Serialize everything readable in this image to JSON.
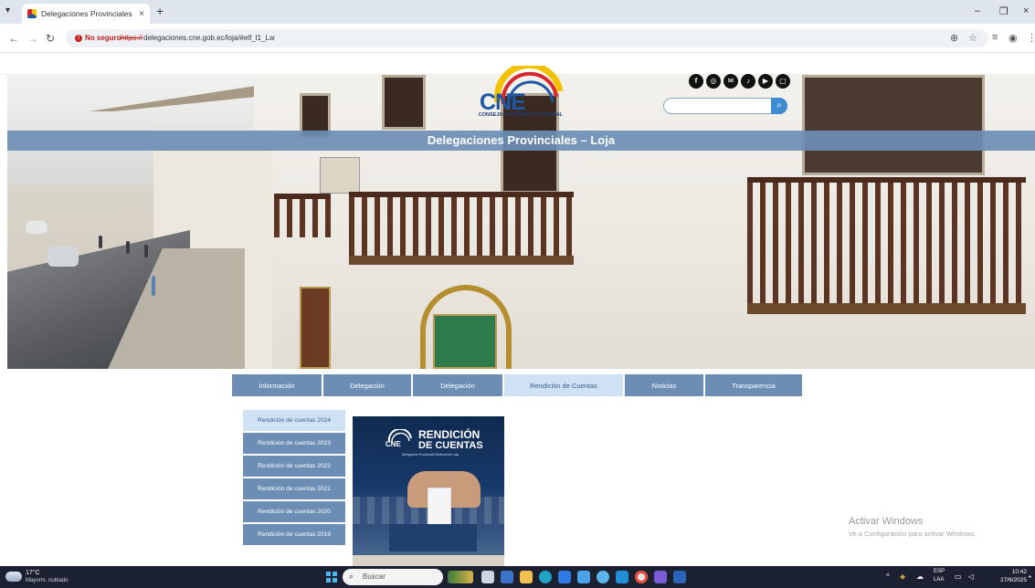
{
  "browser": {
    "tab_title": "Delegaciones Provinciales – Loj",
    "new_tab": "+",
    "close_glyph": "×",
    "menu_glyph": "▾",
    "window_minimize": "–",
    "window_restore": "❐",
    "window_close": "×",
    "insecure_label": "No seguro",
    "url_scheme": "https://",
    "url_rest": "delegaciones.cne.gob.ec/loja/#elf_l1_Lw",
    "icons": [
      "back-icon",
      "forward-icon",
      "reload-icon",
      "zoom-icon",
      "star-icon",
      "extensions-icon",
      "profile-icon",
      "more-icon"
    ]
  },
  "header": {
    "logo_text": "CNE",
    "logo_subtitle": "CONSEJO NACIONAL ELECTORAL",
    "social": [
      "f",
      "◎",
      "✉",
      "♪",
      "▶",
      "▢"
    ],
    "search_placeholder": "",
    "search_glyph": "🔍",
    "page_title": "Delegaciones Provinciales – Loja"
  },
  "menu": [
    {
      "label": "Información",
      "active": false
    },
    {
      "label": "Delegación",
      "active": false
    },
    {
      "label": "Delegación",
      "active": false
    },
    {
      "label": "Rendición de Cuentas",
      "active": true
    },
    {
      "label": "Noticias",
      "active": false
    },
    {
      "label": "Transparencia",
      "active": false
    }
  ],
  "side_list": [
    {
      "label": "Rendición de cuentas 2024",
      "active": true
    },
    {
      "label": "Rendición de cuentas 2023",
      "active": false
    },
    {
      "label": "Rendición de cuentas 2022",
      "active": false
    },
    {
      "label": "Rendición de cuentas 2021",
      "active": false
    },
    {
      "label": "Rendición de cuentas 2020",
      "active": false
    },
    {
      "label": "Rendición de cuentas 2019",
      "active": false
    }
  ],
  "poster": {
    "cne": "CNE",
    "title_line1": "RENDICIÓN",
    "title_line2": "DE CUENTAS",
    "tagline": "Delegación Provincial Electoral de Loja"
  },
  "watermark": {
    "line1": "Activar Windows",
    "line2": "Ve a Configuración para activar Windows."
  },
  "taskbar": {
    "weather_temp": "17°C",
    "weather_desc": "Mayorm. nublado",
    "search_label": "Buscar",
    "lang1": "ESP",
    "lang2": "LAA",
    "time": "10:42",
    "date": "27/6/2025"
  },
  "colors": {
    "menu_blue": "#6c8eb5",
    "menu_active": "#cfe2f3",
    "brand_blue": "#1e57a4",
    "brand_yellow": "#f2c200",
    "brand_red": "#d7262e"
  }
}
